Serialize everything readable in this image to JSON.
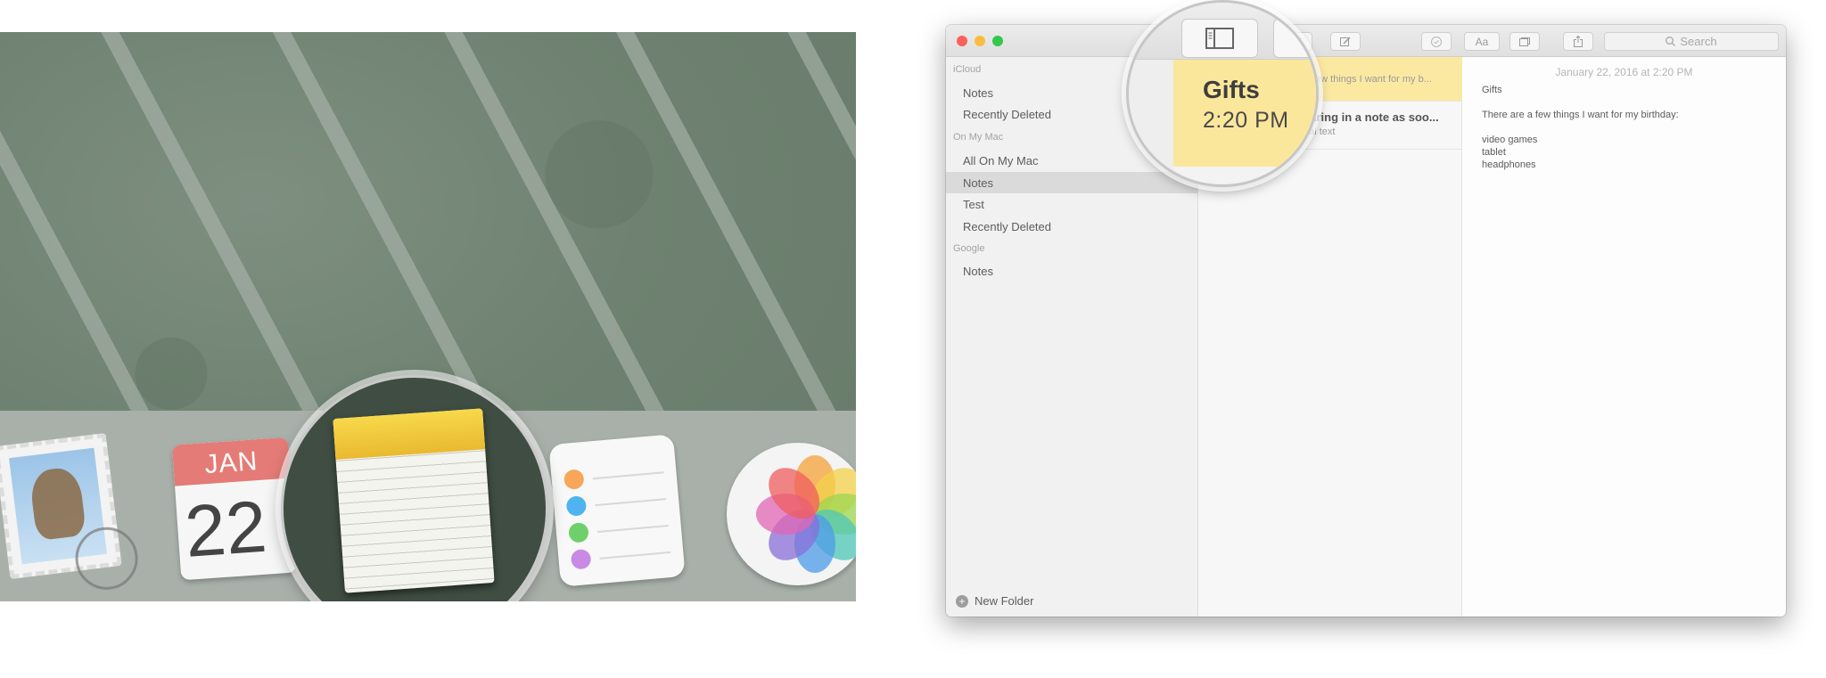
{
  "dock": {
    "calendar_month": "JAN",
    "calendar_day": "22"
  },
  "notes_app": {
    "search": {
      "placeholder": "Search"
    },
    "sidebar": {
      "sections": [
        {
          "label": "iCloud",
          "items": [
            "Notes",
            "Recently Deleted"
          ]
        },
        {
          "label": "On My Mac",
          "items": [
            "All On My Mac",
            "Notes",
            "Test",
            "Recently Deleted"
          ]
        },
        {
          "label": "Google",
          "items": [
            "Notes"
          ]
        }
      ],
      "selected_item": "Notes",
      "new_folder_label": "New Folder"
    },
    "note_list": [
      {
        "title": "Gifts",
        "time": "2:20 PM",
        "snippet": "few things I want for my b..."
      },
      {
        "title": "earing in a note as soo...",
        "snippet": "nal text"
      }
    ],
    "editor": {
      "date": "January 22, 2016 at 2:20 PM",
      "lines": [
        "Gifts",
        "There are a few things I want for my birthday:",
        "video games",
        "tablet",
        "headphones"
      ]
    }
  },
  "colors": {
    "accent_note_yellow": "#fbe79c",
    "close": "#fc605c",
    "minimize": "#fdbc40",
    "zoom": "#34c84a"
  }
}
